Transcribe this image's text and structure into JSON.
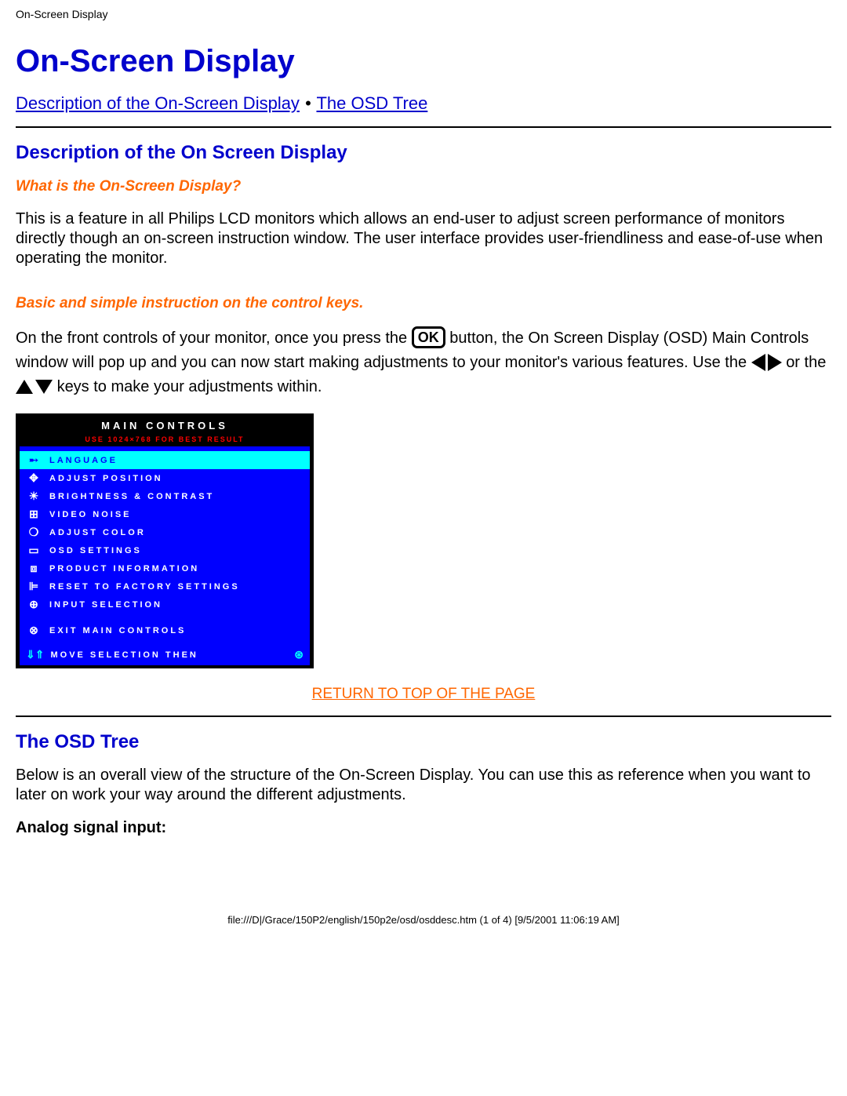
{
  "header": {
    "label": "On-Screen Display"
  },
  "main": {
    "title": "On-Screen Display",
    "nav": {
      "link1": "Description of the On-Screen Display",
      "sep": "•",
      "link2": "The OSD Tree"
    },
    "section1": {
      "heading": "Description of the On Screen Display",
      "q1": "What is the On-Screen Display?",
      "p1": "This is a feature in all Philips LCD monitors which allows an end-user to adjust screen performance of monitors directly though an on-screen instruction window. The user interface provides user-friendliness and ease-of-use when operating the monitor.",
      "q2": "Basic and simple instruction on the control keys.",
      "instr_a": "On the front controls of your monitor, once you press the ",
      "ok_label": "OK",
      "instr_b": " button, the On Screen Display (OSD) Main Controls window will pop up and you can now start making adjustments to your monitor's various features. Use the ",
      "instr_c": " or the ",
      "instr_d": " keys to make your adjustments within."
    },
    "osd": {
      "title": "MAIN CONTROLS",
      "tip": "USE 1024×768 FOR BEST RESULT",
      "items": [
        {
          "icon": "➸",
          "label": "LANGUAGE",
          "selected": true
        },
        {
          "icon": "✥",
          "label": "ADJUST POSITION"
        },
        {
          "icon": "☀",
          "label": "BRIGHTNESS & CONTRAST"
        },
        {
          "icon": "⊞",
          "label": "VIDEO NOISE"
        },
        {
          "icon": "❍",
          "label": "ADJUST COLOR"
        },
        {
          "icon": "▭",
          "label": "OSD SETTINGS"
        },
        {
          "icon": "⧈",
          "label": "PRODUCT INFORMATION"
        },
        {
          "icon": "⊫",
          "label": "RESET TO FACTORY SETTINGS"
        },
        {
          "icon": "⊕",
          "label": "INPUT SELECTION"
        }
      ],
      "exit": {
        "icon": "⊗",
        "label": "EXIT MAIN CONTROLS"
      },
      "footer": {
        "icons": "⇓⇑",
        "label": "MOVE SELECTION THEN",
        "ok": "⊛"
      }
    },
    "return_link": "RETURN TO TOP OF THE PAGE",
    "section2": {
      "heading": "The OSD Tree",
      "p1": "Below is an overall view of the structure of the On-Screen Display. You can use this as reference when you want to later on work your way around the different adjustments.",
      "sub": "Analog signal input:"
    }
  },
  "footer": "file:///D|/Grace/150P2/english/150p2e/osd/osddesc.htm (1 of 4) [9/5/2001 11:06:19 AM]"
}
